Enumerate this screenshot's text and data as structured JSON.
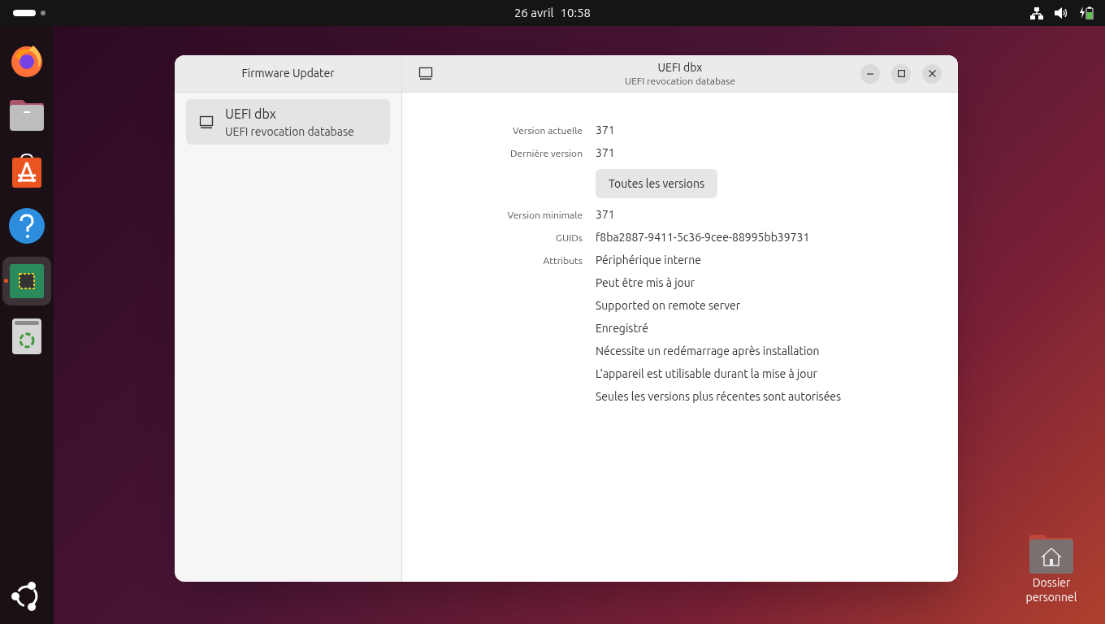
{
  "top_bar": {
    "date": "26 avril",
    "time": "10:58"
  },
  "dock": [
    {
      "kind": "browser",
      "selected": false,
      "running": false
    },
    {
      "kind": "files",
      "selected": false,
      "running": false
    },
    {
      "kind": "store",
      "selected": false,
      "running": false
    },
    {
      "kind": "help",
      "selected": false,
      "running": false
    },
    {
      "kind": "firmware",
      "selected": true,
      "running": true
    },
    {
      "kind": "trash",
      "selected": false,
      "running": false
    }
  ],
  "window": {
    "sidebar_title": "Firmware Updater",
    "title": "UEFI dbx",
    "subtitle": "UEFI revocation database",
    "devices": [
      {
        "name": "UEFI dbx",
        "description": "UEFI revocation database",
        "selected": true
      }
    ],
    "details": [
      {
        "kind": "field",
        "label": "Version actuelle",
        "values": [
          "371"
        ]
      },
      {
        "kind": "field",
        "label": "Dernière version",
        "values": [
          "371"
        ]
      },
      {
        "kind": "button",
        "label": "Toutes les versions"
      },
      {
        "kind": "field",
        "label": "Version minimale",
        "values": [
          "371"
        ]
      },
      {
        "kind": "field",
        "label": "GUIDs",
        "values": [
          "f8ba2887-9411-5c36-9cee-88995bb39731"
        ]
      },
      {
        "kind": "field",
        "label": "Attributs",
        "values": [
          "Périphérique interne",
          "Peut être mis à jour",
          "Supported on remote server",
          "Enregistré",
          "Nécessite un redémarrage après installation",
          "L’appareil est utilisable durant la mise à jour",
          "Seules les versions plus récentes sont autorisées"
        ]
      }
    ]
  },
  "desktop_icons": [
    {
      "label": "Dossier personnel"
    }
  ]
}
